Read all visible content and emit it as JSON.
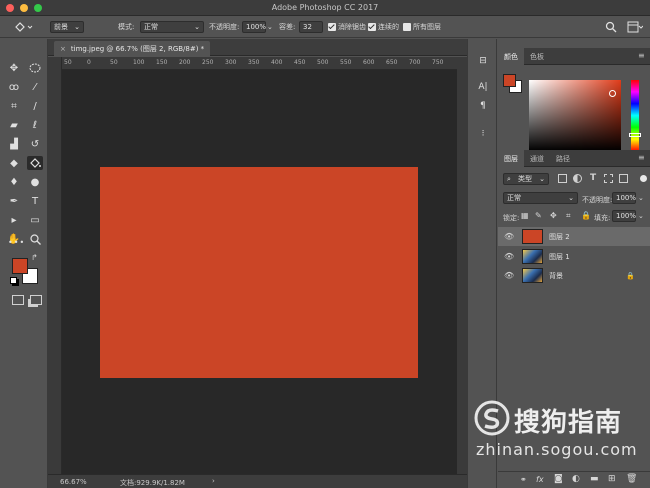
{
  "window": {
    "title": "Adobe Photoshop CC 2017"
  },
  "options_bar": {
    "fill_source": "前景",
    "mode_label": "模式:",
    "mode_value": "正常",
    "opacity_label": "不透明度:",
    "opacity_value": "100%",
    "tolerance_label": "容差:",
    "tolerance_value": "32",
    "antialias_label": "消除锯齿",
    "contiguous_label": "连续的",
    "all_layers_label": "所有图层"
  },
  "document": {
    "tab_label": "timg.jpeg @ 66.7% (图层 2, RGB/8#) *",
    "ruler_ticks": [
      "50",
      "0",
      "50",
      "100",
      "150",
      "200",
      "250",
      "300",
      "350",
      "400",
      "450",
      "500",
      "550",
      "600",
      "650",
      "700",
      "750"
    ],
    "fill_color": "#cb4526",
    "zoom": "66.67%",
    "doc_info": "文档:929.9K/1.82M",
    "status_arrow": "›"
  },
  "tools": {
    "foreground_color": "#cb4526",
    "background_color": "#ffffff",
    "icons": [
      "move-icon",
      "marquee-icon",
      "lasso-icon",
      "magic-wand-icon",
      "crop-icon",
      "eyedropper-icon",
      "healing-icon",
      "brush-icon",
      "stamp-icon",
      "history-brush-icon",
      "eraser-icon",
      "paint-bucket-icon",
      "blur-icon",
      "dodge-icon",
      "pen-icon",
      "type-icon",
      "path-select-icon",
      "rectangle-icon",
      "hand-icon",
      "zoom-icon",
      "more-icon"
    ]
  },
  "color_panel": {
    "tabs": [
      "颜色",
      "色板"
    ]
  },
  "layers_panel": {
    "tabs": [
      "图层",
      "通道",
      "路径"
    ],
    "filter_label": "类型",
    "blend_mode": "正常",
    "opacity_label": "不透明度:",
    "opacity_value": "100%",
    "lock_label": "锁定:",
    "fill_label": "填充:",
    "fill_value": "100%",
    "layers": [
      {
        "name": "图层 2",
        "selected": true
      },
      {
        "name": "图层 1",
        "selected": false
      },
      {
        "name": "背景",
        "selected": false,
        "locked": true
      }
    ],
    "footer_fx": "fx"
  },
  "watermark": {
    "brand": "搜狗指南",
    "url": "zhinan.sogou.com"
  }
}
